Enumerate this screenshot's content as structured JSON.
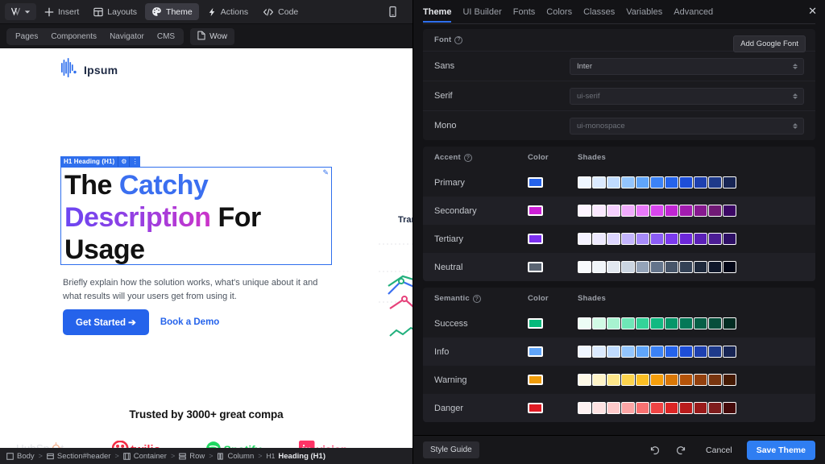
{
  "toolbar": {
    "logo_icon": "brand-v-logo",
    "caret_icon": "chevron-down-icon",
    "items": [
      {
        "label": "Insert",
        "icon": "plus-icon",
        "active": false
      },
      {
        "label": "Layouts",
        "icon": "grid-icon",
        "active": false
      },
      {
        "label": "Theme",
        "icon": "palette-icon",
        "active": true
      },
      {
        "label": "Actions",
        "icon": "bolt-icon",
        "active": false
      },
      {
        "label": "Code",
        "icon": "code-icon",
        "active": false
      }
    ],
    "device_icon": "mobile-device-icon"
  },
  "subbar": {
    "groups": [
      "Pages",
      "Components",
      "Navigator",
      "CMS"
    ],
    "page_tab": {
      "label": "Wow",
      "icon": "page-icon"
    }
  },
  "canvas": {
    "site_logo": {
      "text": "Ipsum",
      "icon": "soundwave-logo-icon"
    },
    "selection_badge": {
      "label": "H1 Heading (H1)",
      "gear_icon": "gear-icon",
      "more_icon": "more-vertical-icon",
      "edit_icon": "pencil-square-icon"
    },
    "heading": {
      "part1": "The ",
      "part2": "Catchy Description",
      "part3": " For Usage"
    },
    "paragraph": "Briefly explain how the solution works, what's unique about it and what results will your users get from using it.",
    "cta_primary": "Get Started ➔",
    "cta_secondary": "Book a Demo",
    "chart_label": "Tran",
    "trusted": "Trusted by 3000+ great compa",
    "logos": [
      "HubSpot",
      "twilio",
      "Spotify",
      "invision"
    ]
  },
  "breadcrumb": [
    {
      "label": "Body",
      "icon": "square-icon"
    },
    {
      "label": "Section#header",
      "icon": "section-icon"
    },
    {
      "label": "Container",
      "icon": "container-icon"
    },
    {
      "label": "Row",
      "icon": "row-icon"
    },
    {
      "label": "Column",
      "icon": "column-icon"
    },
    {
      "label": "Heading (H1)",
      "prefix": "H1",
      "icon": "heading-icon"
    }
  ],
  "panel": {
    "tabs": [
      {
        "label": "Theme",
        "active": true
      },
      {
        "label": "UI Builder",
        "active": false
      },
      {
        "label": "Fonts",
        "active": false
      },
      {
        "label": "Colors",
        "active": false
      },
      {
        "label": "Classes",
        "active": false
      },
      {
        "label": "Variables",
        "active": false
      },
      {
        "label": "Advanced",
        "active": false
      }
    ],
    "close_icon": "close-icon",
    "font_section": {
      "title": "Font",
      "add_google_font": "Add Google Font",
      "rows": [
        {
          "label": "Sans",
          "value": "Inter",
          "muted": false
        },
        {
          "label": "Serif",
          "value": "ui-serif",
          "muted": true
        },
        {
          "label": "Mono",
          "value": "ui-monospace",
          "muted": true
        }
      ]
    },
    "accent_section": {
      "title": "Accent",
      "col_color": "Color",
      "col_shades": "Shades",
      "rows": [
        {
          "label": "Primary",
          "color": "#2563eb",
          "shades": [
            "#eff6ff",
            "#dbeafe",
            "#bfdbfe",
            "#93c5fd",
            "#60a5fa",
            "#3b82f6",
            "#2563eb",
            "#1d4ed8",
            "#1e40af",
            "#1e3a8a",
            "#172554"
          ]
        },
        {
          "label": "Secondary",
          "color": "#cc1fd6",
          "shades": [
            "#fdf4ff",
            "#fae8ff",
            "#f5d0fe",
            "#f0abfc",
            "#e879f9",
            "#d946ef",
            "#c026d3",
            "#a21caf",
            "#86198f",
            "#701a75",
            "#3b0764"
          ]
        },
        {
          "label": "Tertiary",
          "color": "#7c2ff0",
          "shades": [
            "#f5f3ff",
            "#ede9fe",
            "#ddd6fe",
            "#c4b5fd",
            "#a78bfa",
            "#8b5cf6",
            "#7c3aed",
            "#6d28d9",
            "#5b21b6",
            "#4c1d95",
            "#2e1065"
          ]
        },
        {
          "label": "Neutral",
          "color": "#5b6573",
          "shades": [
            "#f8fafc",
            "#f1f5f9",
            "#e2e8f0",
            "#cbd5e1",
            "#94a3b8",
            "#64748b",
            "#475569",
            "#334155",
            "#1e293b",
            "#0f172a",
            "#020617"
          ]
        }
      ]
    },
    "semantic_section": {
      "title": "Semantic",
      "col_color": "Color",
      "col_shades": "Shades",
      "rows": [
        {
          "label": "Success",
          "color": "#06b97c",
          "shades": [
            "#ecfdf5",
            "#d1fae5",
            "#a7f3d0",
            "#6ee7b7",
            "#34d399",
            "#10b981",
            "#059669",
            "#047857",
            "#065f46",
            "#064e3b",
            "#022c22"
          ]
        },
        {
          "label": "Info",
          "color": "#60a5fa",
          "shades": [
            "#eff6ff",
            "#dbeafe",
            "#bfdbfe",
            "#93c5fd",
            "#60a5fa",
            "#3b82f6",
            "#2563eb",
            "#1d4ed8",
            "#1e40af",
            "#1e3a8a",
            "#172554"
          ]
        },
        {
          "label": "Warning",
          "color": "#f09c0a",
          "shades": [
            "#fef9e7",
            "#fef3c7",
            "#fde68a",
            "#fcd34d",
            "#fbbf24",
            "#f59e0b",
            "#d97706",
            "#b45309",
            "#92400e",
            "#78350f",
            "#451a03"
          ]
        },
        {
          "label": "Danger",
          "color": "#e01b24",
          "shades": [
            "#fef2f2",
            "#fee2e2",
            "#fecaca",
            "#fca5a5",
            "#f87171",
            "#ef4444",
            "#dc2626",
            "#b91c1c",
            "#991b1b",
            "#7f1d1d",
            "#450a0a"
          ]
        }
      ]
    },
    "footer": {
      "style_guide": "Style Guide",
      "undo_icon": "undo-icon",
      "redo_icon": "redo-icon",
      "cancel": "Cancel",
      "save": "Save Theme"
    }
  }
}
